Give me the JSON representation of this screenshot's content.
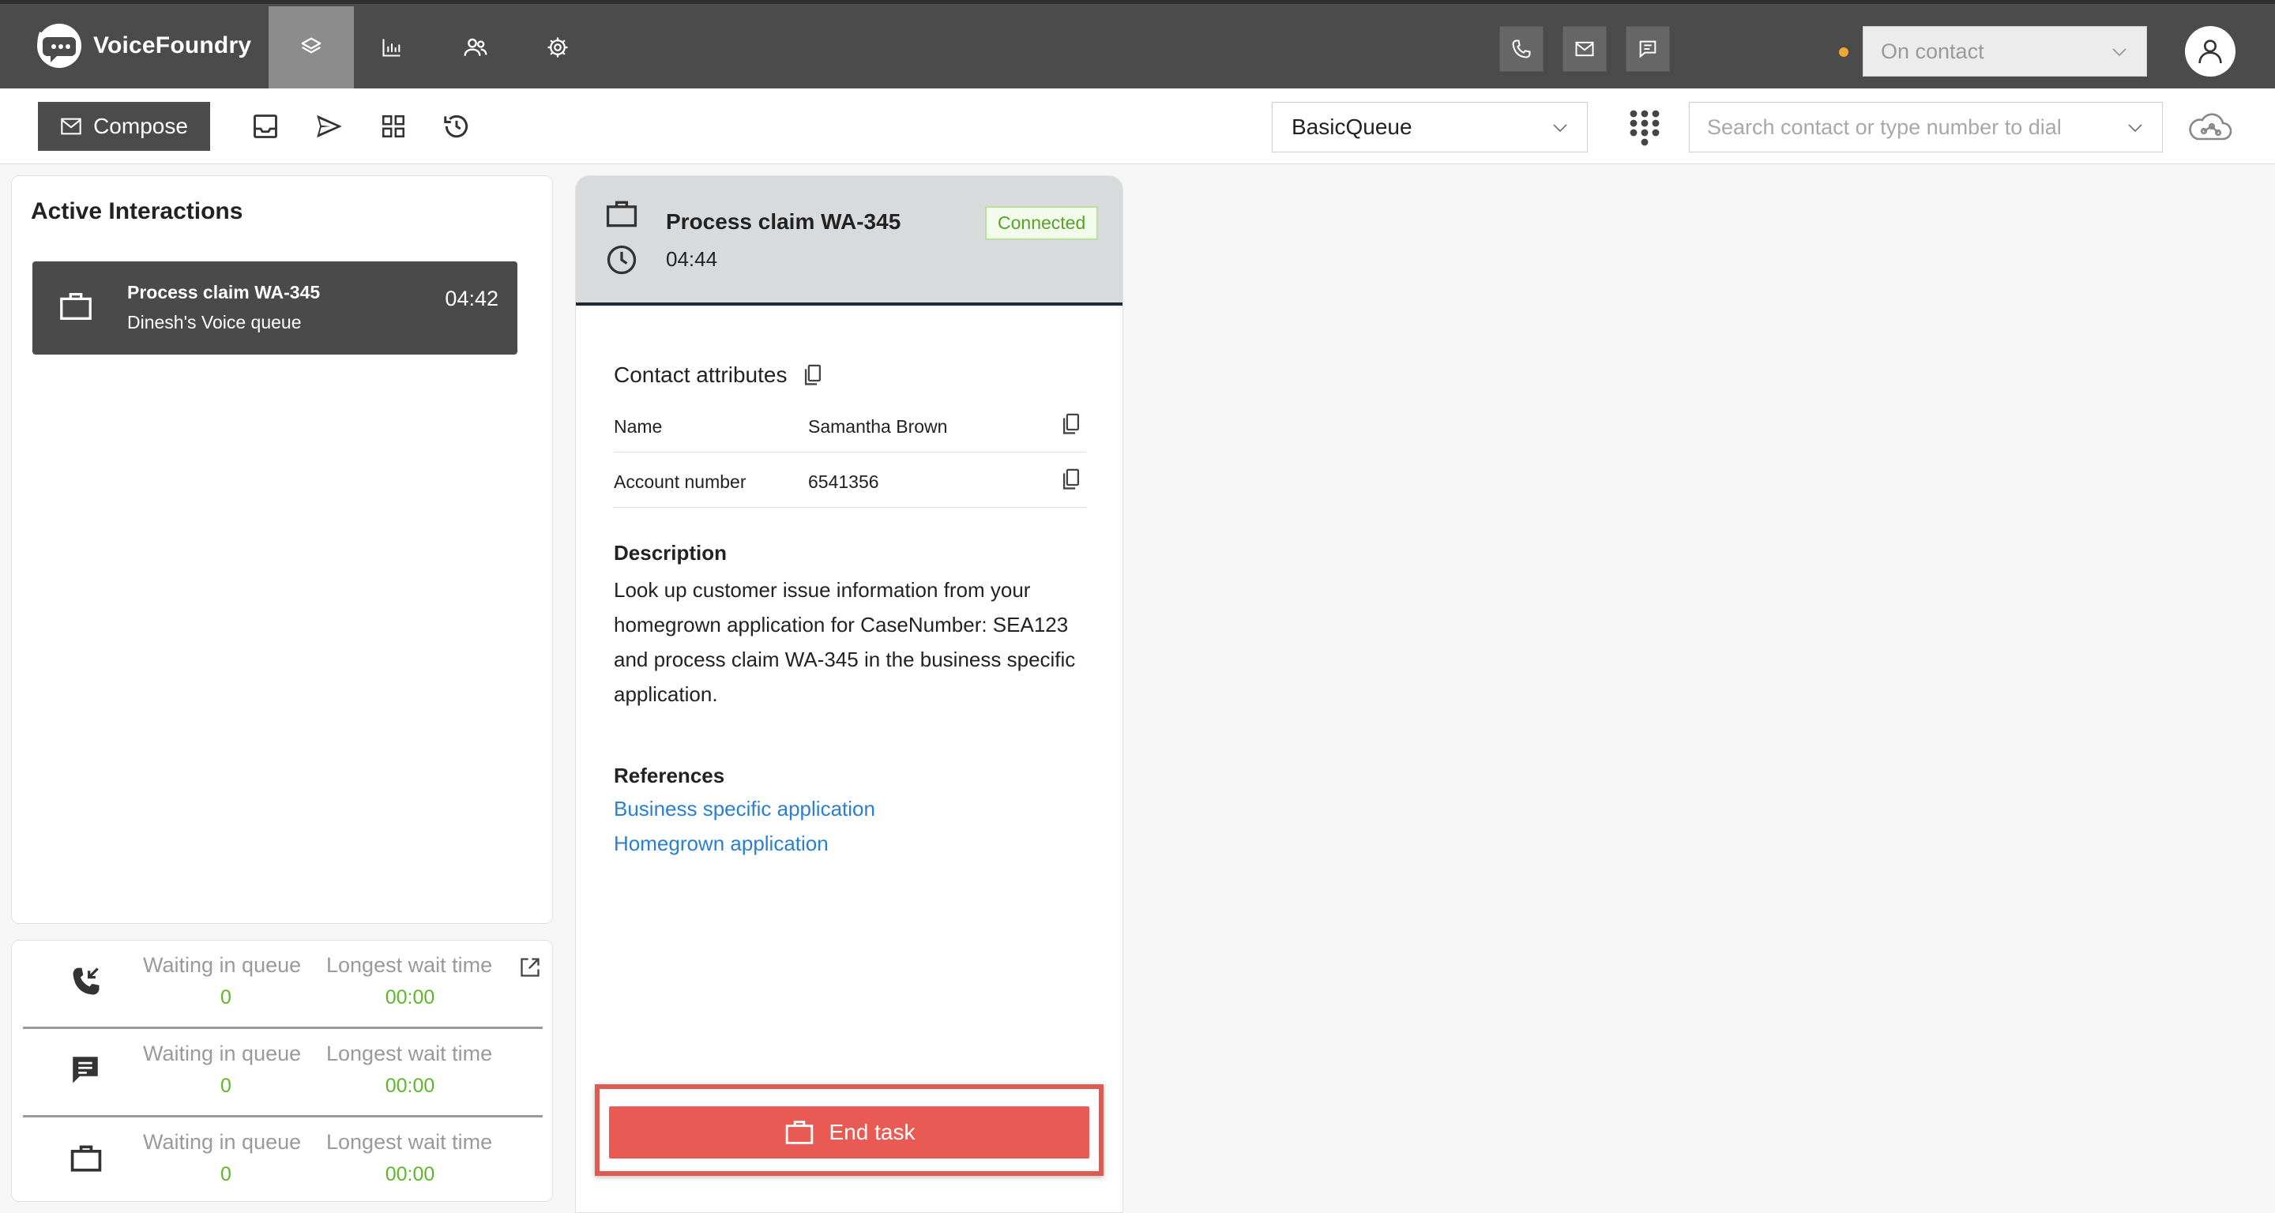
{
  "app": {
    "name": "VoiceFoundry"
  },
  "topbar": {
    "status": "On contact",
    "status_color": "#f0a830",
    "nav_icons": [
      "layers-icon",
      "bar-chart-icon",
      "users-icon",
      "gear-icon"
    ],
    "channel_icons": [
      "phone-icon",
      "mail-icon",
      "chat-icon"
    ]
  },
  "toolbar": {
    "compose_label": "Compose",
    "icons": [
      "inbox-icon",
      "send-icon",
      "grid-icon",
      "history-icon"
    ],
    "queue_selected": "BasicQueue",
    "search_placeholder": "Search contact or type number to dial"
  },
  "active_interactions": {
    "title": "Active Interactions",
    "items": [
      {
        "title": "Process claim WA-345",
        "subtitle": "Dinesh's Voice queue",
        "timer": "04:42",
        "icon": "briefcase-icon"
      }
    ]
  },
  "queue_stats": [
    {
      "channel_icon": "incoming-call-icon",
      "waiting_label": "Waiting in queue",
      "waiting_value": "0",
      "wait_label": "Longest wait time",
      "wait_value": "00:00"
    },
    {
      "channel_icon": "chat-icon",
      "waiting_label": "Waiting in queue",
      "waiting_value": "0",
      "wait_label": "Longest wait time",
      "wait_value": "00:00"
    },
    {
      "channel_icon": "briefcase-icon",
      "waiting_label": "Waiting in queue",
      "waiting_value": "0",
      "wait_label": "Longest wait time",
      "wait_value": "00:00"
    }
  ],
  "task": {
    "title": "Process claim WA-345",
    "timer": "04:44",
    "status": "Connected",
    "attributes_title": "Contact attributes",
    "attributes": [
      {
        "key": "Name",
        "value": "Samantha Brown"
      },
      {
        "key": "Account number",
        "value": "6541356"
      }
    ],
    "description_title": "Description",
    "description": "Look up customer issue information from your homegrown application for CaseNumber: SEA123 and process claim WA-345 in the business specific application.",
    "references_title": "References",
    "references": [
      "Business specific application",
      "Homegrown application"
    ],
    "end_label": "End task"
  },
  "colors": {
    "topbar": "#4b4b4b",
    "connected_green": "#58a12a",
    "stat_green": "#5cb82a",
    "link_blue": "#2a7fd4",
    "end_red": "#ea5a54"
  }
}
